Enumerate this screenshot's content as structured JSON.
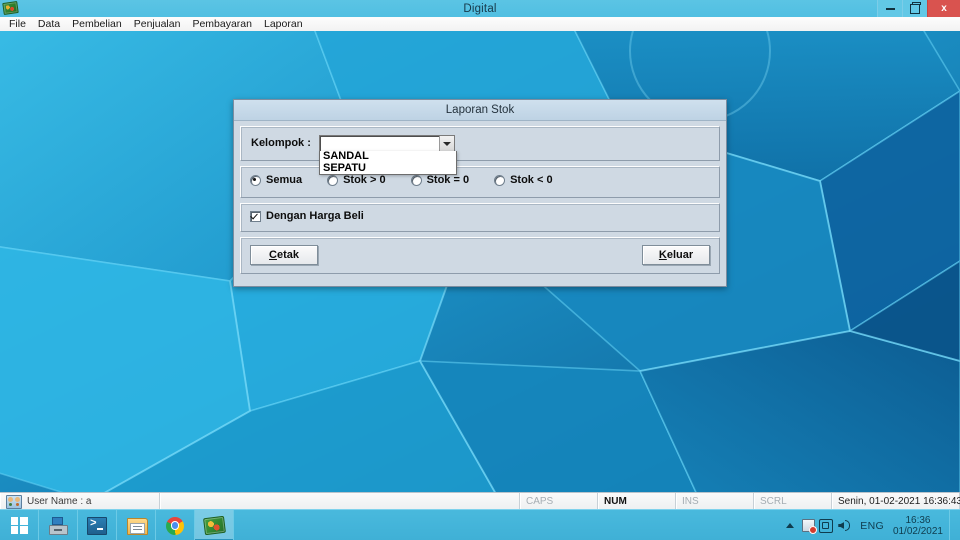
{
  "window": {
    "title": "Digital",
    "app_icon": "money-stack-icon",
    "controls": {
      "minimize": "minimize-icon",
      "maximize": "restore-icon",
      "close": "x"
    }
  },
  "menubar": {
    "items": [
      {
        "label": "File"
      },
      {
        "label": "Data"
      },
      {
        "label": "Pembelian"
      },
      {
        "label": "Penjualan"
      },
      {
        "label": "Pembayaran"
      },
      {
        "label": "Laporan"
      }
    ]
  },
  "dialog": {
    "title": "Laporan Stok",
    "kelompok": {
      "label": "Kelompok :",
      "value": "",
      "placeholder": "",
      "dropdown_open": true,
      "options": [
        "SANDAL",
        "SEPATU"
      ]
    },
    "stok_filter": {
      "selected": "Semua",
      "options": [
        {
          "label": "Semua",
          "checked": true
        },
        {
          "label": "Stok > 0",
          "checked": false
        },
        {
          "label": "Stok = 0",
          "checked": false
        },
        {
          "label": "Stok < 0",
          "checked": false
        }
      ]
    },
    "harga_beli": {
      "label": "Dengan Harga Beli",
      "checked": true
    },
    "buttons": {
      "print": {
        "accel": "C",
        "rest": "etak"
      },
      "exit": {
        "accel": "K",
        "rest": "eluar"
      }
    }
  },
  "statusbar": {
    "user_icon": "users-icon",
    "user_label": "User Name : a",
    "indicators": [
      {
        "label": "CAPS",
        "active": false
      },
      {
        "label": "NUM",
        "active": true
      },
      {
        "label": "INS",
        "active": false
      },
      {
        "label": "SCRL",
        "active": false
      }
    ],
    "datetime": "Senin, 01-02-2021 16:36:43"
  },
  "taskbar": {
    "start": "windows-logo-icon",
    "items": [
      {
        "icon": "server-manager-icon",
        "open": false
      },
      {
        "icon": "powershell-icon",
        "open": false
      },
      {
        "icon": "file-explorer-icon",
        "open": false
      },
      {
        "icon": "chrome-icon",
        "open": false
      },
      {
        "icon": "digital-app-icon",
        "open": true
      }
    ],
    "tray": {
      "chevron": "show-hidden-icons",
      "network": "network-error-icon",
      "action_center": "action-center-icon",
      "volume": "volume-icon",
      "language": "ENG",
      "clock_time": "16:36",
      "clock_date": "01/02/2021"
    }
  },
  "theme": {
    "titlebar_bg": "#51bfe2",
    "close_button": "#d9534f",
    "desktop_blue": "#1b8fc4",
    "dialog_face": "#cfd9e3",
    "taskbar_bg": "#3fb0d6"
  }
}
